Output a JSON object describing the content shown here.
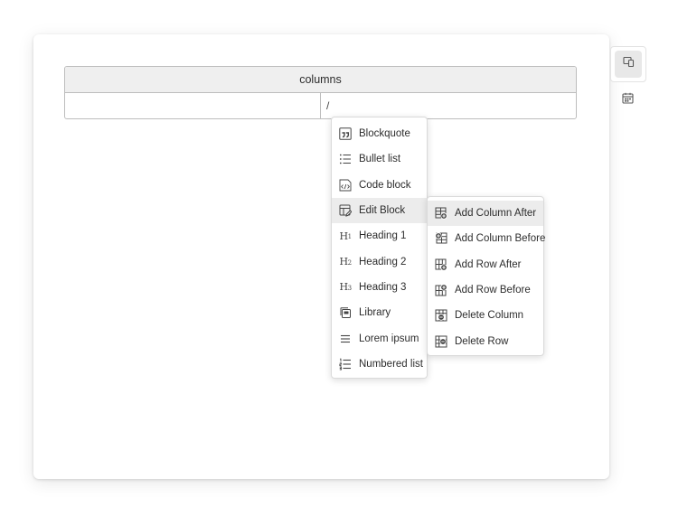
{
  "block": {
    "header": "columns",
    "cell_left": "",
    "cell_right": "/"
  },
  "side_rail": {
    "items": [
      {
        "icon": "devices-icon",
        "active": true
      },
      {
        "icon": "calendar-icon",
        "active": false
      }
    ]
  },
  "slash_menu": {
    "items": [
      {
        "label": "Blockquote",
        "icon": "quote-icon"
      },
      {
        "label": "Bullet list",
        "icon": "bullet-list-icon"
      },
      {
        "label": "Code block",
        "icon": "code-block-icon"
      },
      {
        "label": "Edit Block",
        "icon": "edit-block-icon",
        "hovered": true
      },
      {
        "label": "Heading 1",
        "icon": "heading-1-icon",
        "glyph": "H",
        "level": "1"
      },
      {
        "label": "Heading 2",
        "icon": "heading-2-icon",
        "glyph": "H",
        "level": "2"
      },
      {
        "label": "Heading 3",
        "icon": "heading-3-icon",
        "glyph": "H",
        "level": "3"
      },
      {
        "label": "Library",
        "icon": "library-icon"
      },
      {
        "label": "Lorem ipsum",
        "icon": "text-lines-icon"
      },
      {
        "label": "Numbered list",
        "icon": "numbered-list-icon"
      }
    ]
  },
  "sub_menu": {
    "items": [
      {
        "label": "Add Column After",
        "icon": "add-column-after-icon",
        "hovered": true
      },
      {
        "label": "Add Column Before",
        "icon": "add-column-before-icon"
      },
      {
        "label": "Add Row After",
        "icon": "add-row-after-icon"
      },
      {
        "label": "Add Row Before",
        "icon": "add-row-before-icon"
      },
      {
        "label": "Delete Column",
        "icon": "delete-column-icon"
      },
      {
        "label": "Delete Row",
        "icon": "delete-row-icon"
      }
    ]
  }
}
